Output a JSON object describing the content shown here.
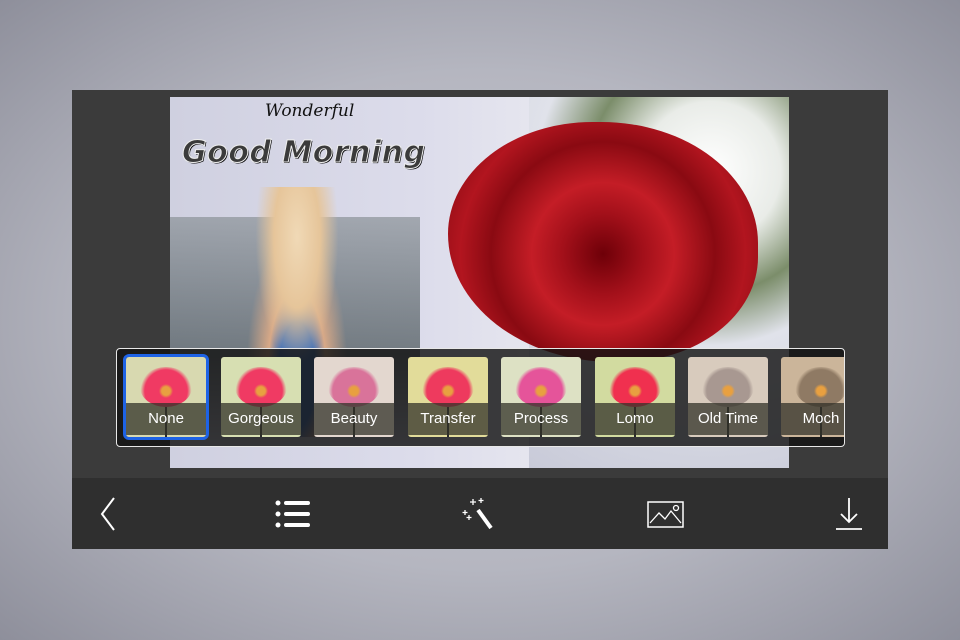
{
  "photo": {
    "subtitle": "Wonderful",
    "title": "Good Morning"
  },
  "filters": [
    {
      "label": "None",
      "selected": true,
      "bg": "#d8d9b0",
      "flower": "#f03a63"
    },
    {
      "label": "Gorgeous",
      "selected": false,
      "bg": "#d7dfb2",
      "flower": "#f03a63"
    },
    {
      "label": "Beauty",
      "selected": false,
      "bg": "#e3d7cf",
      "flower": "#d9739a"
    },
    {
      "label": "Transfer",
      "selected": false,
      "bg": "#e2dc9a",
      "flower": "#ee3a5e"
    },
    {
      "label": "Process",
      "selected": false,
      "bg": "#dde1c4",
      "flower": "#e5549a"
    },
    {
      "label": "Lomo",
      "selected": false,
      "bg": "#d2dba0",
      "flower": "#f0304f"
    },
    {
      "label": "Old Time",
      "selected": false,
      "bg": "#d8cbbd",
      "flower": "#a89891"
    },
    {
      "label": "Moch",
      "selected": false,
      "bg": "#cbb59a",
      "flower": "#8f7a64"
    }
  ],
  "toolbar": {
    "icons": [
      "back-chevron-icon",
      "list-icon",
      "magic-wand-icon",
      "image-icon",
      "download-icon"
    ]
  },
  "colors": {
    "selected_outline": "#1e63e6",
    "panel": "#3b3b3b",
    "toolbar": "#2f2f2f"
  }
}
